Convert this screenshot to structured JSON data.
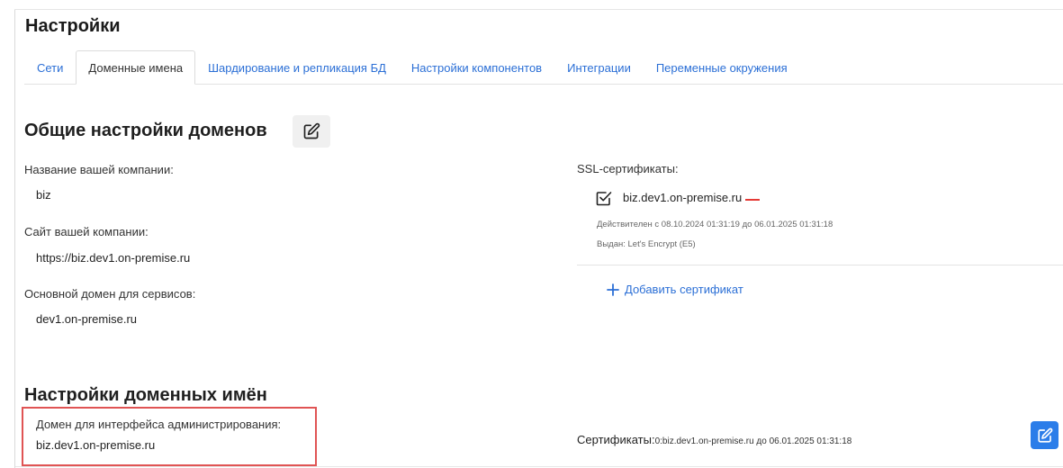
{
  "page": {
    "title": "Настройки"
  },
  "tabs": [
    {
      "label": "Сети",
      "active": false
    },
    {
      "label": "Доменные имена",
      "active": true
    },
    {
      "label": "Шардирование и репликация БД",
      "active": false
    },
    {
      "label": "Настройки компонентов",
      "active": false
    },
    {
      "label": "Интеграции",
      "active": false
    },
    {
      "label": "Переменные окружения",
      "active": false
    }
  ],
  "general": {
    "title": "Общие настройки доменов",
    "company_name_label": "Название вашей компании:",
    "company_name_value": "biz",
    "company_site_label": "Сайт вашей компании:",
    "company_site_value": "https://biz.dev1.on-premise.ru",
    "main_domain_label": "Основной домен для сервисов:",
    "main_domain_value": "dev1.on-premise.ru"
  },
  "ssl": {
    "label": "SSL-сертификаты:",
    "certificate": {
      "name": "biz.dev1.on-premise.ru",
      "valid": "Действителен с 08.10.2024 01:31:19 до 06.01.2025 01:31:18",
      "issuer": "Выдан: Let's Encrypt (E5)"
    },
    "add_label": "Добавить сертификат"
  },
  "domain_names": {
    "title": "Настройки доменных имён",
    "admin_domain_label": "Домен для интерфейса администрирования:",
    "admin_domain_value": "biz.dev1.on-premise.ru",
    "certs_label": "Сертификаты:",
    "certs_value": "0:biz.dev1.on-premise.ru до 06.01.2025 01:31:18"
  },
  "colors": {
    "accent": "#2b6fd6",
    "button_blue": "#2b7de9",
    "remove_red": "#e53935",
    "highlight": "#e05454"
  }
}
